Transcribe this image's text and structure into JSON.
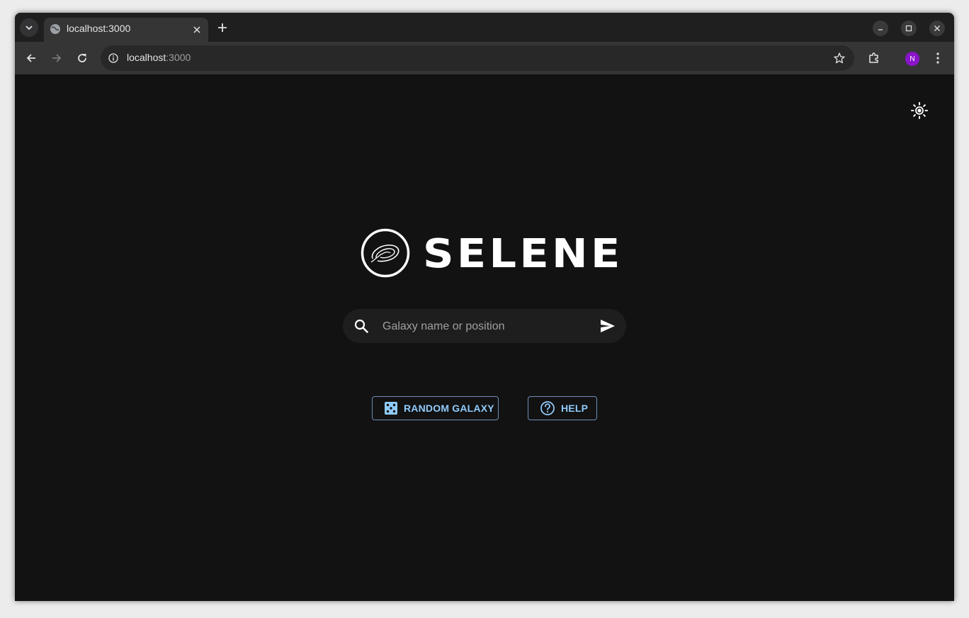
{
  "browser": {
    "tab": {
      "title": "localhost:3000"
    },
    "address": {
      "host": "localhost",
      "port": ":3000"
    },
    "profile_initial": "N"
  },
  "page": {
    "logo_text": "SELENE",
    "search": {
      "placeholder": "Galaxy name or position"
    },
    "buttons": {
      "random_label": "RANDOM GALAXY",
      "help_label": "HELP"
    }
  },
  "colors": {
    "accent": "#90caf9",
    "background": "#121212",
    "profile": "#8a14c9"
  }
}
